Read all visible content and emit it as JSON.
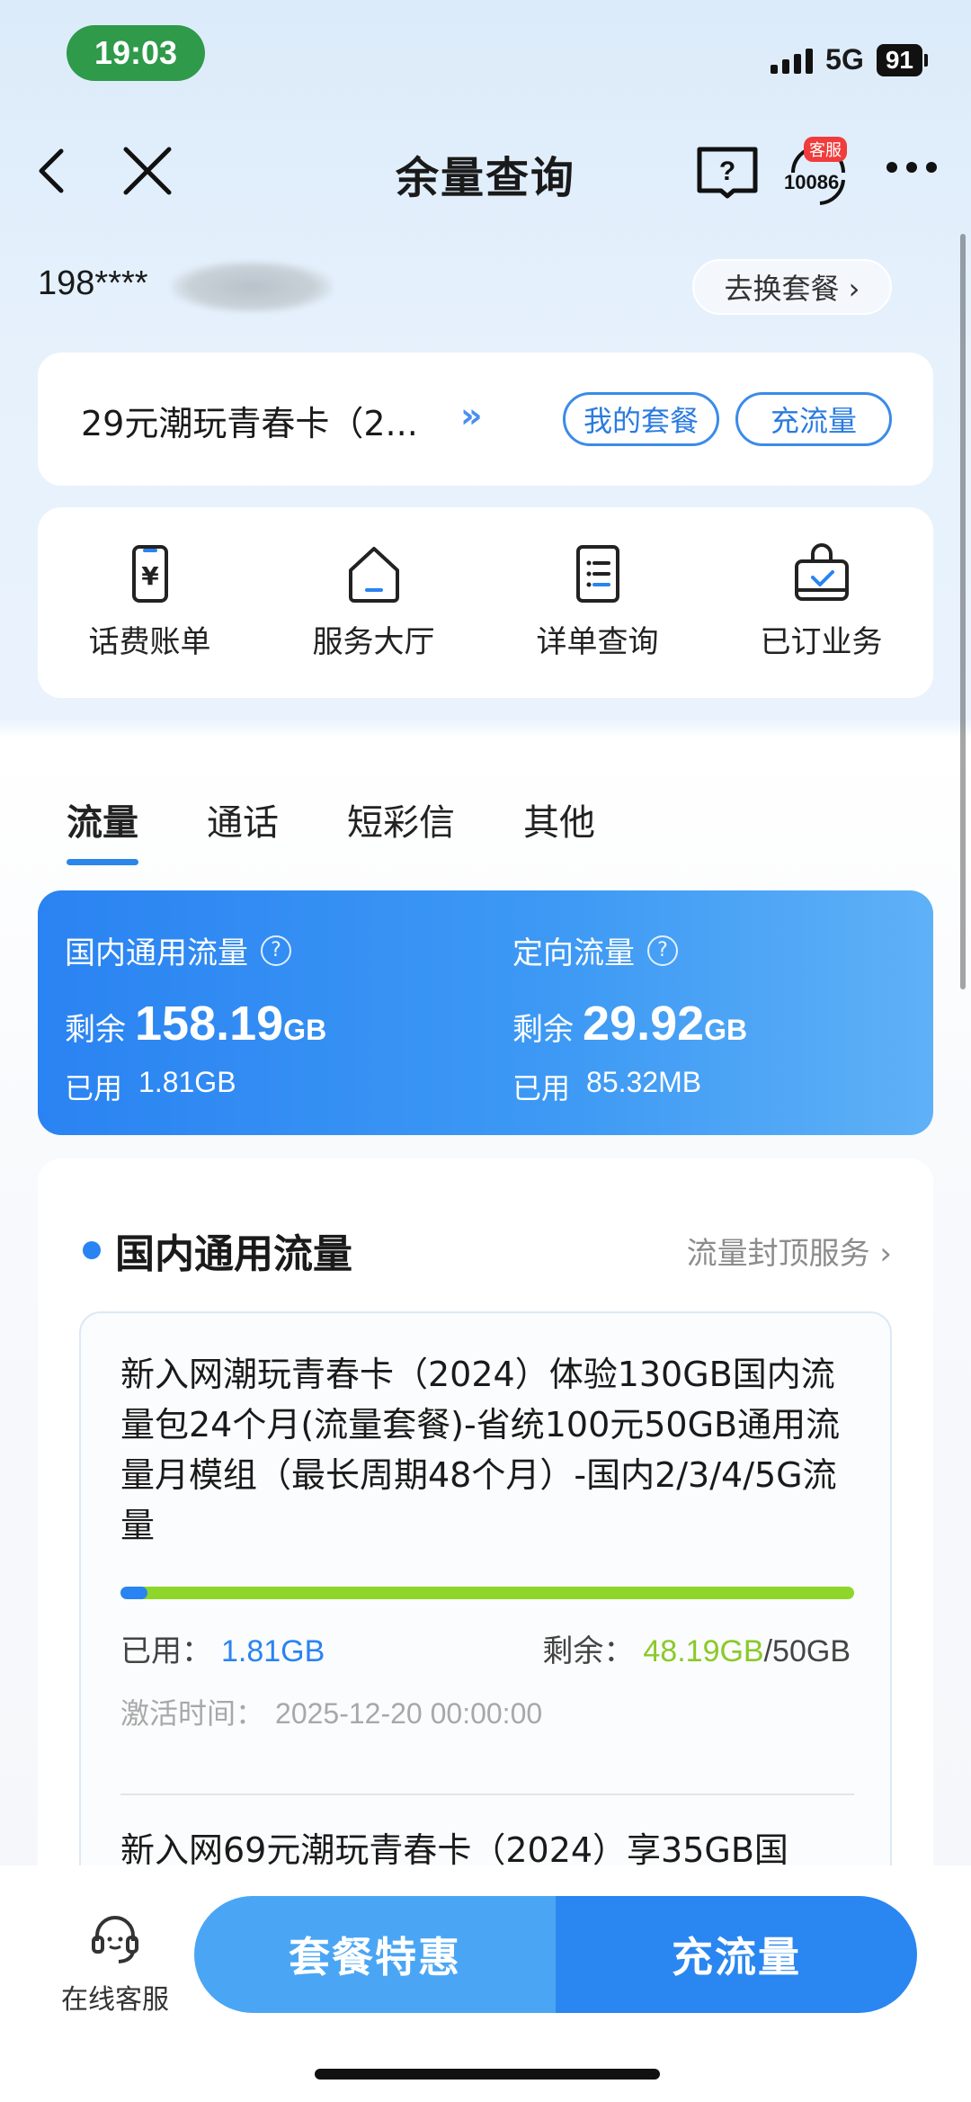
{
  "status": {
    "time": "19:03",
    "network": "5G",
    "battery": "91"
  },
  "nav": {
    "title": "余量查询",
    "service_badge": "客服",
    "service_number": "10086"
  },
  "account": {
    "phone": "198****",
    "switch_label": "去换套餐 ›"
  },
  "plan": {
    "name": "29元潮玩青春卡（2...",
    "arrow": "»",
    "my_plan": "我的套餐",
    "recharge": "充流量"
  },
  "services": [
    {
      "label": "话费账单",
      "icon": "bill-icon"
    },
    {
      "label": "服务大厅",
      "icon": "home-icon"
    },
    {
      "label": "详单查询",
      "icon": "list-icon"
    },
    {
      "label": "已订业务",
      "icon": "bag-icon"
    }
  ],
  "tabs": [
    "流量",
    "通话",
    "短彩信",
    "其他"
  ],
  "summary": {
    "domestic": {
      "title": "国内通用流量",
      "remain_label": "剩余",
      "remain_value": "158.19",
      "remain_unit": "GB",
      "used_label": "已用",
      "used_value": "1.81GB"
    },
    "directional": {
      "title": "定向流量",
      "remain_label": "剩余",
      "remain_value": "29.92",
      "remain_unit": "GB",
      "used_label": "已用",
      "used_value": "85.32MB"
    },
    "help_glyph": "?"
  },
  "detail": {
    "title": "国内通用流量",
    "cap_link": "流量封顶服务 ›",
    "package": {
      "name": "新入网潮玩青春卡（2024）体验130GB国内流量包24个月(流量套餐)-省统100元50GB通用流量月模组（最长周期48个月）-国内2/3/4/5G流量",
      "used_label": "已用：",
      "used_value": "1.81GB",
      "remain_label": "剩余：",
      "remain_value": "48.19GB",
      "total": "/50GB",
      "used_fraction": 0.0362,
      "activate_label": "激活时间：",
      "activate_value": "2025-12-20 00:00:00"
    },
    "next_package_partial": "新入网69元潮玩青春卡（2024）享35GB国"
  },
  "bottom": {
    "kefu_label": "在线客服",
    "offer": "套餐特惠",
    "recharge": "充流量"
  },
  "colors": {
    "accent": "#2a83f2",
    "remain_green": "#8ac92a",
    "status_green": "#2e9a4a"
  }
}
